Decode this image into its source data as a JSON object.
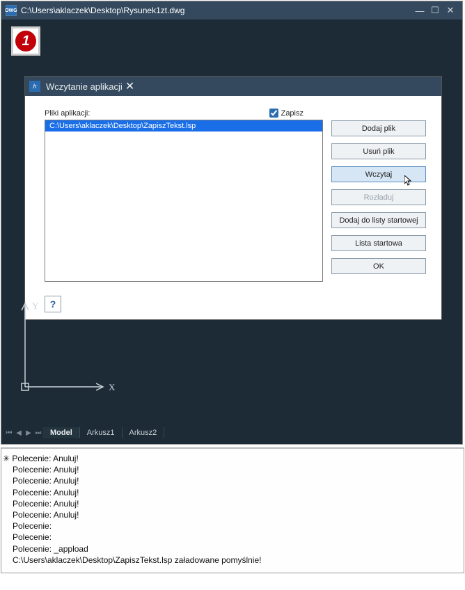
{
  "window": {
    "title": "C:\\Users\\aklaczek\\Desktop\\Rysunek1zt.dwg",
    "icon_label": "DWG"
  },
  "badge": {
    "number": "1"
  },
  "dialog": {
    "title": "Wczytanie aplikacji",
    "files_label": "Pliki aplikacji:",
    "save_label": "Zapisz",
    "list": {
      "items": [
        "C:\\Users\\aklaczek\\Desktop\\ZapiszTekst.lsp"
      ]
    },
    "buttons": {
      "add": "Dodaj plik",
      "remove": "Usuń plik",
      "load": "Wczytaj",
      "unload": "Rozładuj",
      "addstart": "Dodaj do listy startowej",
      "startlist": "Lista startowa",
      "ok": "OK"
    },
    "help": "?"
  },
  "axes": {
    "x": "X",
    "y": "Y"
  },
  "tabs": {
    "model": "Model",
    "a1": "Arkusz1",
    "a2": "Arkusz2"
  },
  "cmd": {
    "l1": "Polecenie: Anuluj!",
    "l2": "Polecenie: Anuluj!",
    "l3": "Polecenie: Anuluj!",
    "l4": "Polecenie: Anuluj!",
    "l5": "Polecenie: Anuluj!",
    "l6": "Polecenie: Anuluj!",
    "l7": "Polecenie:",
    "l8": "Polecenie:",
    "l9": "Polecenie: _appload",
    "l10": "C:\\Users\\aklaczek\\Desktop\\ZapiszTekst.lsp załadowane pomyślnie!"
  }
}
